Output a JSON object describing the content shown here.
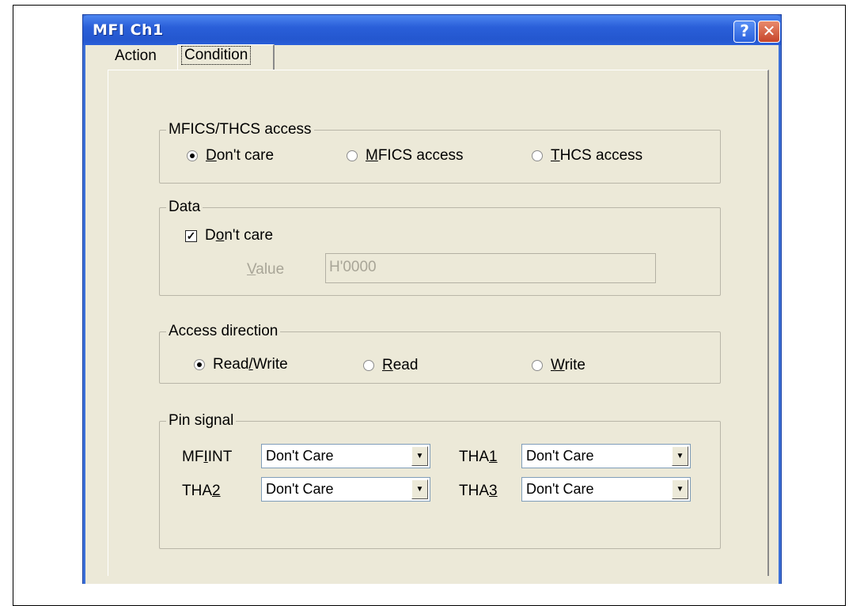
{
  "window": {
    "title": "MFI Ch1",
    "help_glyph": "?",
    "close_glyph": "✕"
  },
  "tabs": [
    {
      "label": "Action"
    },
    {
      "label": "Condition"
    }
  ],
  "mfics_group": {
    "label": "MFICS/THCS access",
    "options": [
      {
        "label": "Don't care",
        "mnemonic": "D",
        "rest": "on't care",
        "checked": true
      },
      {
        "label": "MFICS access",
        "mnemonic": "M",
        "rest": "FICS access",
        "checked": false
      },
      {
        "label": "THCS access",
        "mnemonic": "T",
        "rest": "HCS access",
        "checked": false
      }
    ]
  },
  "data_group": {
    "label": "Data",
    "dont_care": {
      "pre": "D",
      "mnemonic": "o",
      "rest": "n't care",
      "checked": true
    },
    "value_label": {
      "mnemonic": "V",
      "rest": "alue"
    },
    "value": "H'0000"
  },
  "access_group": {
    "label": "Access direction",
    "options": [
      {
        "pre": "Read",
        "mnemonic": "/",
        "rest": "Write",
        "checked": true
      },
      {
        "pre": "",
        "mnemonic": "R",
        "rest": "ead",
        "checked": false
      },
      {
        "pre": "",
        "mnemonic": "W",
        "rest": "rite",
        "checked": false
      }
    ]
  },
  "pin_group": {
    "label": "Pin signal",
    "mfiint": {
      "pre": "MF",
      "mnemonic": "I",
      "rest": "INT",
      "value": "Don't Care"
    },
    "tha1": {
      "pre": "THA",
      "mnemonic": "1",
      "value": "Don't Care"
    },
    "tha2": {
      "pre": "THA",
      "mnemonic": "2",
      "value": "Don't Care"
    },
    "tha3": {
      "pre": "THA",
      "mnemonic": "3",
      "value": "Don't Care"
    }
  }
}
